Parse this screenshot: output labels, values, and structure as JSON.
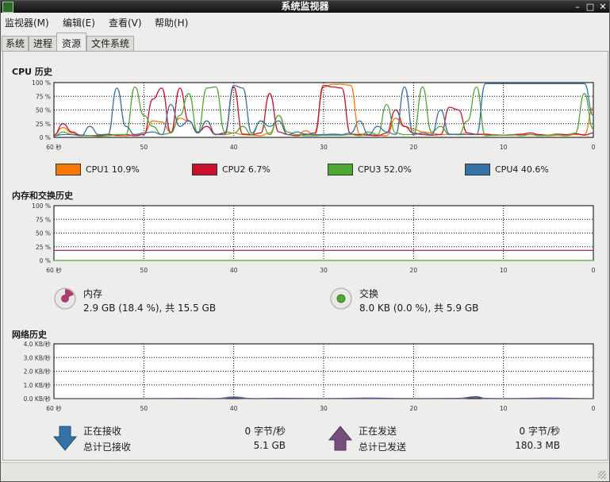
{
  "window": {
    "title": "系统监视器"
  },
  "menu": [
    "监视器(M)",
    "编辑(E)",
    "查看(V)",
    "帮助(H)"
  ],
  "tabs": [
    "系统",
    "进程",
    "资源",
    "文件系统"
  ],
  "active_tab": "资源",
  "cpu": {
    "title": "CPU 历史",
    "y_ticks": [
      "100 %",
      "75 %",
      "50 %",
      "25 %",
      "0 %"
    ],
    "x_ticks": [
      "60 秒",
      "50",
      "40",
      "30",
      "20",
      "10",
      "0"
    ],
    "legend": [
      {
        "label": "CPU1",
        "value": "10.9%",
        "color": "#f57900"
      },
      {
        "label": "CPU2",
        "value": "6.7%",
        "color": "#cc0f2a"
      },
      {
        "label": "CPU3",
        "value": "52.0%",
        "color": "#4ea832"
      },
      {
        "label": "CPU4",
        "value": "40.6%",
        "color": "#3572a5"
      }
    ]
  },
  "memory": {
    "title": "内存和交换历史",
    "y_ticks": [
      "100 %",
      "75 %",
      "50 %",
      "25 %",
      "0 %"
    ],
    "x_ticks": [
      "60 秒",
      "50",
      "40",
      "30",
      "20",
      "10",
      "0"
    ],
    "mem_label": "内存",
    "mem_value": "2.9 GB (18.4 %), 共 15.5 GB",
    "mem_color": "#ad3b6c",
    "swap_label": "交换",
    "swap_value": "8.0 KB (0.0 %), 共 5.9 GB",
    "swap_color": "#4ea832"
  },
  "network": {
    "title": "网络历史",
    "y_ticks": [
      "4.0 KB/秒",
      "3.0 KB/秒",
      "2.0 KB/秒",
      "1.0 KB/秒",
      "0.0 KB/秒"
    ],
    "x_ticks": [
      "60 秒",
      "50",
      "40",
      "30",
      "20",
      "10",
      "0"
    ],
    "recv_label": "正在接收",
    "recv_rate": "0 字节/秒",
    "recv_total_label": "总计已接收",
    "recv_total": "5.1 GB",
    "recv_color": "#3572a5",
    "send_label": "正在发送",
    "send_rate": "0 字节/秒",
    "send_total_label": "总计已发送",
    "send_total": "180.3 MB",
    "send_color": "#75507b"
  },
  "chart_data": [
    {
      "type": "line",
      "title": "CPU 历史",
      "xlabel": "",
      "ylabel": "",
      "xlim": [
        60,
        0
      ],
      "ylim": [
        0,
        100
      ],
      "grid": true,
      "x": [
        60,
        59,
        58,
        57,
        56,
        55,
        54,
        53,
        52,
        51,
        50,
        49,
        48,
        47,
        46,
        45,
        44,
        43,
        42,
        41,
        40,
        39,
        38,
        37,
        36,
        35,
        34,
        33,
        32,
        31,
        30,
        29,
        28,
        27,
        26,
        25,
        24,
        23,
        22,
        21,
        20,
        19,
        18,
        17,
        16,
        15,
        14,
        13,
        12,
        11,
        10,
        9,
        8,
        7,
        6,
        5,
        4,
        3,
        2,
        1,
        0
      ],
      "series": [
        {
          "name": "CPU1",
          "values": [
            5,
            18,
            8,
            3,
            3,
            4,
            6,
            3,
            3,
            5,
            8,
            30,
            28,
            10,
            35,
            30,
            8,
            30,
            6,
            5,
            8,
            5,
            4,
            3,
            8,
            40,
            5,
            3,
            12,
            4,
            92,
            97,
            97,
            95,
            6,
            5,
            4,
            3,
            35,
            20,
            15,
            10,
            8,
            5,
            5,
            6,
            8,
            6,
            5,
            5,
            4,
            4,
            5,
            5,
            4,
            3,
            4,
            3,
            5,
            5,
            55
          ]
        },
        {
          "name": "CPU2",
          "values": [
            4,
            25,
            10,
            4,
            3,
            3,
            5,
            4,
            5,
            3,
            5,
            70,
            90,
            8,
            90,
            30,
            10,
            20,
            5,
            8,
            92,
            6,
            5,
            8,
            80,
            10,
            5,
            3,
            5,
            8,
            95,
            92,
            90,
            6,
            5,
            4,
            3,
            8,
            50,
            20,
            8,
            5,
            4,
            5,
            55,
            50,
            8,
            5,
            6,
            4,
            4,
            5,
            6,
            8,
            5,
            4,
            6,
            5,
            7,
            4,
            8
          ]
        },
        {
          "name": "CPU3",
          "values": [
            2,
            10,
            5,
            3,
            3,
            2,
            3,
            5,
            5,
            92,
            40,
            20,
            5,
            8,
            40,
            80,
            8,
            90,
            92,
            10,
            8,
            20,
            5,
            30,
            5,
            40,
            10,
            5,
            3,
            3,
            4,
            4,
            4,
            5,
            3,
            10,
            5,
            60,
            8,
            5,
            5,
            92,
            10,
            20,
            5,
            5,
            30,
            92,
            3,
            4,
            4,
            5,
            3,
            5,
            3,
            4,
            5,
            3,
            8,
            80,
            15
          ]
        },
        {
          "name": "CPU4",
          "values": [
            3,
            5,
            5,
            3,
            20,
            5,
            5,
            90,
            20,
            5,
            8,
            10,
            5,
            60,
            20,
            30,
            8,
            30,
            5,
            5,
            95,
            90,
            8,
            30,
            20,
            30,
            5,
            10,
            6,
            5,
            5,
            6,
            5,
            8,
            30,
            5,
            20,
            10,
            5,
            92,
            5,
            8,
            5,
            50,
            6,
            5,
            5,
            5,
            98,
            98,
            98,
            98,
            98,
            98,
            98,
            98,
            98,
            98,
            98,
            98,
            40
          ]
        }
      ]
    },
    {
      "type": "line",
      "title": "内存和交换历史",
      "xlabel": "",
      "ylabel": "",
      "xlim": [
        60,
        0
      ],
      "ylim": [
        0,
        100
      ],
      "grid": true,
      "x": [
        60,
        0
      ],
      "series": [
        {
          "name": "内存",
          "values": [
            18.4,
            18.4
          ]
        },
        {
          "name": "交换",
          "values": [
            0.0,
            0.0
          ]
        }
      ]
    },
    {
      "type": "line",
      "title": "网络历史",
      "xlabel": "",
      "ylabel": "",
      "xlim": [
        60,
        0
      ],
      "ylim": [
        0,
        4
      ],
      "grid": true,
      "x": [
        60,
        55,
        50,
        45,
        42,
        40,
        38,
        35,
        30,
        25,
        20,
        15,
        13,
        12,
        10,
        5,
        0
      ],
      "series": [
        {
          "name": "正在接收",
          "values": [
            0,
            0,
            0,
            0.02,
            0,
            0.12,
            0,
            0.03,
            0,
            0.04,
            0,
            0.02,
            0.15,
            0.02,
            0,
            0.04,
            0
          ]
        },
        {
          "name": "正在发送",
          "values": [
            0,
            0,
            0,
            0,
            0,
            0.05,
            0,
            0,
            0,
            0,
            0,
            0,
            0.08,
            0,
            0,
            0,
            0
          ]
        }
      ]
    }
  ]
}
